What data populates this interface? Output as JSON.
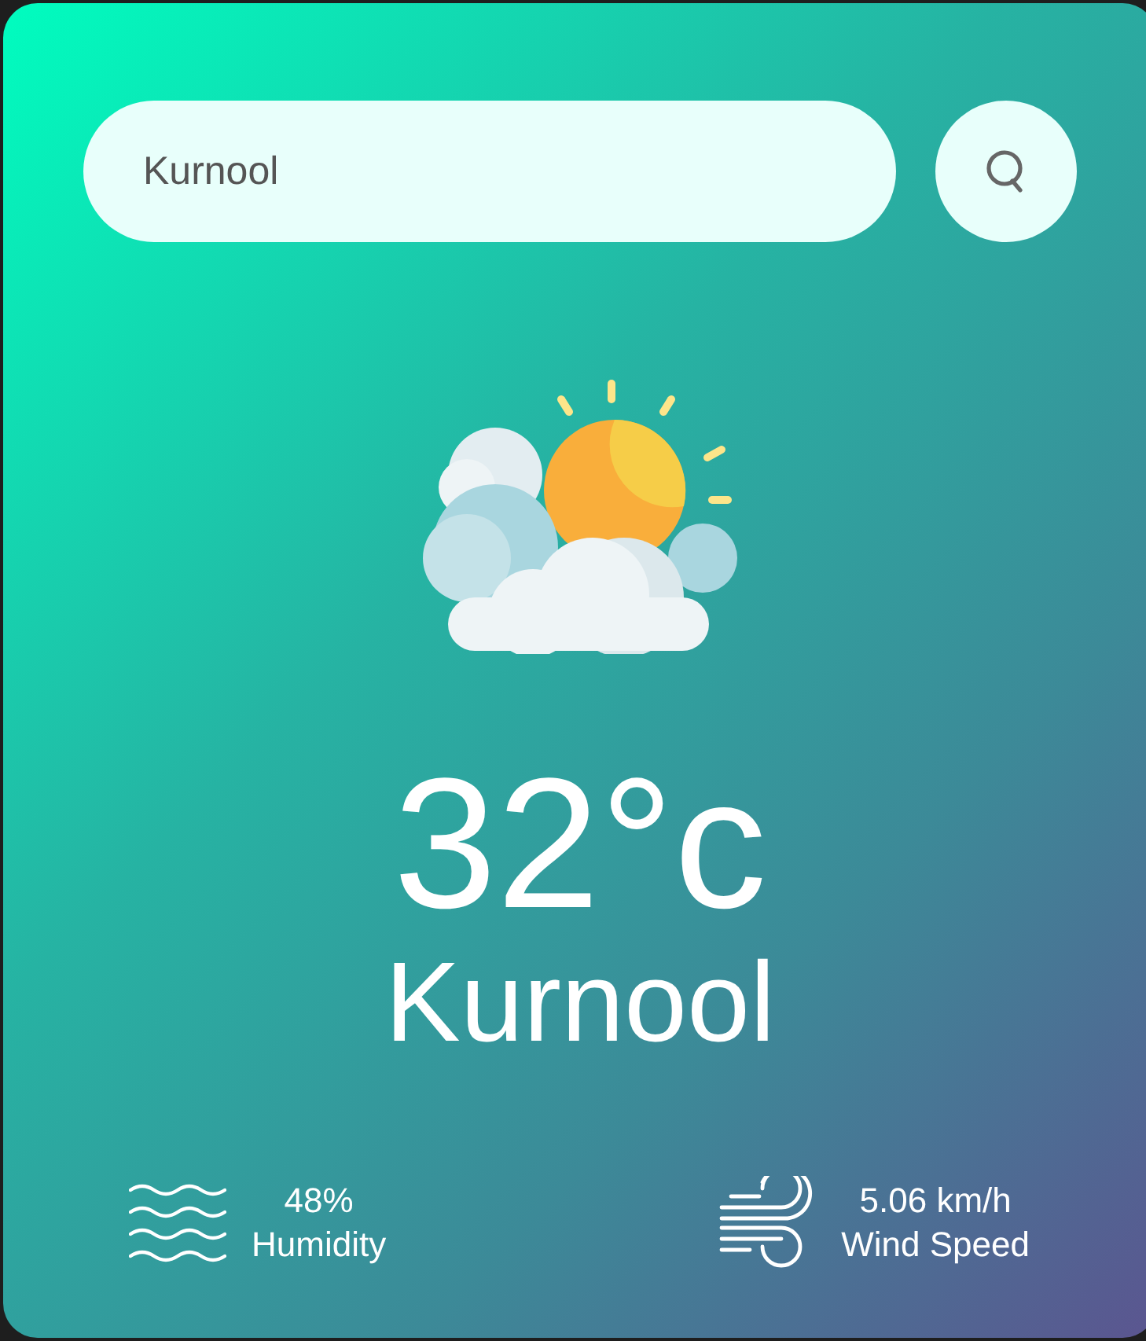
{
  "search": {
    "value": "Kurnool"
  },
  "weather": {
    "temperature": "32°c",
    "city": "Kurnool"
  },
  "details": [
    {
      "kind": "humidity",
      "value": "48%",
      "label": "Humidity"
    },
    {
      "kind": "wind",
      "value": "5.06 km/h",
      "label": "Wind Speed"
    }
  ]
}
